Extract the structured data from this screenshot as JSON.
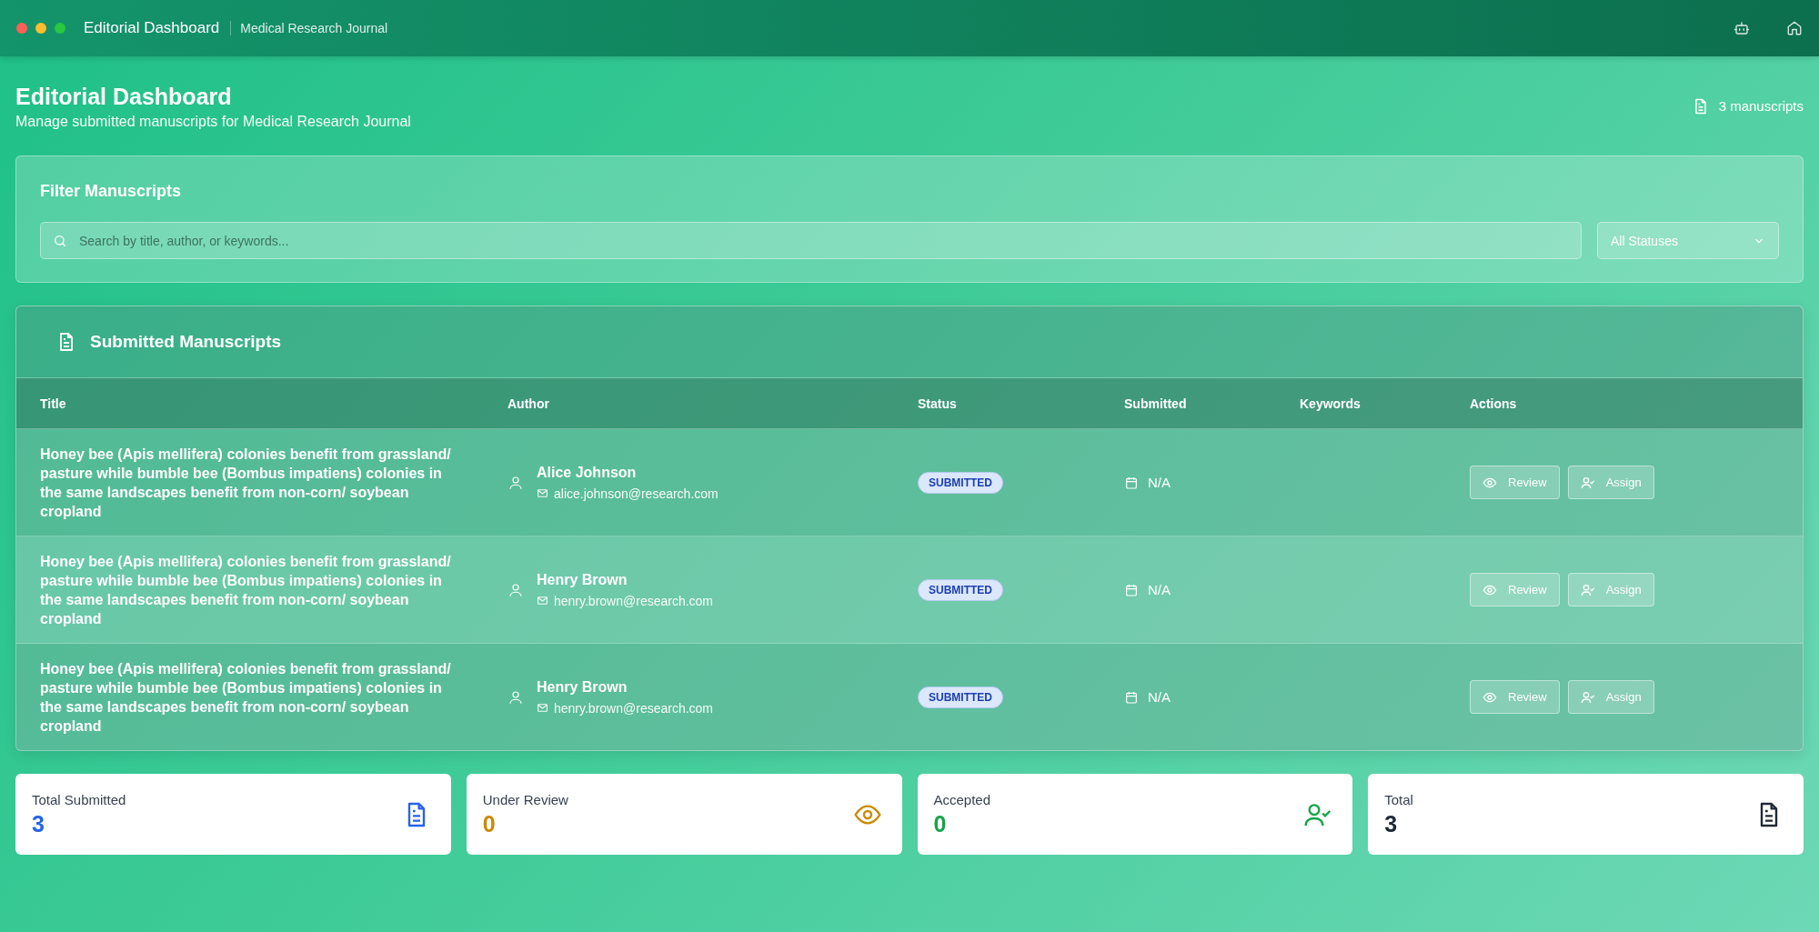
{
  "window": {
    "title": "Editorial Dashboard",
    "subtitle": "Medical Research Journal"
  },
  "header": {
    "title": "Editorial Dashboard",
    "subtitle": "Manage submitted manuscripts for Medical Research Journal",
    "count": "3 manuscripts"
  },
  "filter": {
    "title": "Filter Manuscripts",
    "search": {
      "placeholder": "Search by title, author, or keywords..."
    },
    "status_select": {
      "value": "All Statuses"
    }
  },
  "table": {
    "title": "Submitted Manuscripts",
    "columns": [
      "Title",
      "Author",
      "Status",
      "Submitted",
      "Keywords",
      "Actions"
    ],
    "rows": [
      {
        "title": "Honey bee (Apis mellifera) colonies benefit from grassland/ pasture while bumble bee (Bombus impatiens) colonies in the same landscapes benefit from non-corn/ soybean cropland",
        "author": "Alice Johnson",
        "email": "alice.johnson@research.com",
        "status": "SUBMITTED",
        "submitted": "N/A",
        "actions": [
          "Review",
          "Assign"
        ]
      },
      {
        "title": "Honey bee (Apis mellifera) colonies benefit from grassland/ pasture while bumble bee (Bombus impatiens) colonies in the same landscapes benefit from non-corn/ soybean cropland",
        "author": "Henry Brown",
        "email": "henry.brown@research.com",
        "status": "SUBMITTED",
        "submitted": "N/A",
        "actions": [
          "Review",
          "Assign"
        ]
      },
      {
        "title": "Honey bee (Apis mellifera) colonies benefit from grassland/ pasture while bumble bee (Bombus impatiens) colonies in the same landscapes benefit from non-corn/ soybean cropland",
        "author": "Henry Brown",
        "email": "henry.brown@research.com",
        "status": "SUBMITTED",
        "submitted": "N/A",
        "actions": [
          "Review",
          "Assign"
        ]
      }
    ]
  },
  "stats": [
    {
      "label": "Total Submitted",
      "value": "3",
      "color": "#2563eb",
      "kind": "document"
    },
    {
      "label": "Under Review",
      "value": "0",
      "color": "#ca8a04",
      "kind": "eye"
    },
    {
      "label": "Accepted",
      "value": "0",
      "color": "#16a34a",
      "kind": "user-check"
    },
    {
      "label": "Total",
      "value": "3",
      "color": "#1f2937",
      "kind": "document"
    }
  ]
}
